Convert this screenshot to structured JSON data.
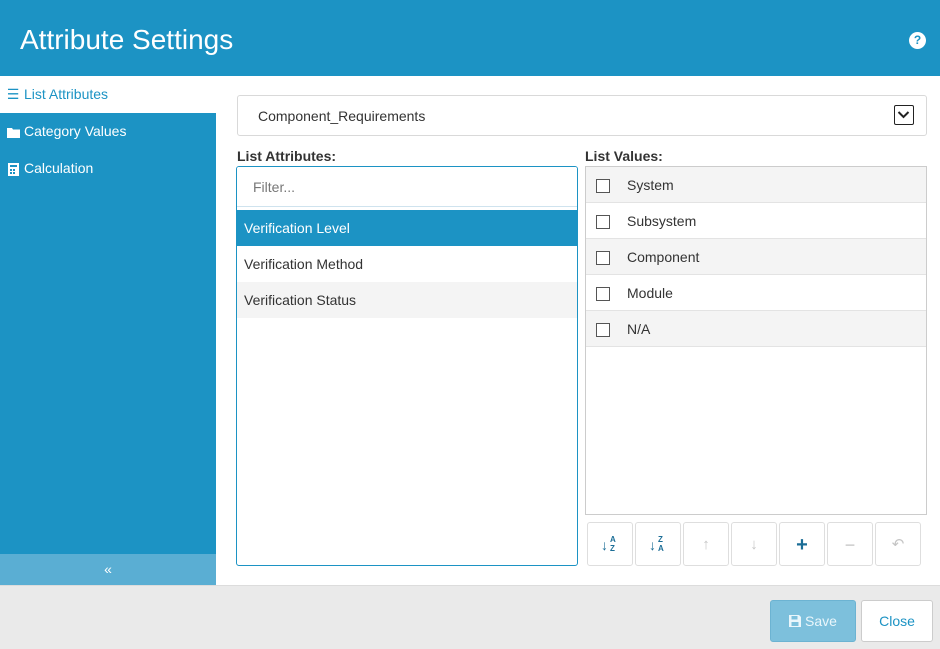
{
  "header": {
    "title": "Attribute Settings",
    "help_icon": "help-circle-icon"
  },
  "sidebar": {
    "items": [
      {
        "label": "List Attributes",
        "icon": "list-icon",
        "active": true
      },
      {
        "label": "Category Values",
        "icon": "folder-icon",
        "active": false
      },
      {
        "label": "Calculation",
        "icon": "calculator-icon",
        "active": false
      }
    ],
    "collapse_label": "«"
  },
  "dropdown": {
    "value": "Component_Requirements"
  },
  "attributes": {
    "label": "List Attributes:",
    "filter_placeholder": "Filter...",
    "items": [
      "Verification Level",
      "Verification Method",
      "Verification Status"
    ],
    "selected_index": 0
  },
  "values": {
    "label": "List Values:",
    "items": [
      "System",
      "Subsystem",
      "Component",
      "Module",
      "N/A"
    ]
  },
  "toolbar": {
    "buttons": [
      {
        "icon": "sort-ascending-icon",
        "enabled": true
      },
      {
        "icon": "sort-descending-icon",
        "enabled": true
      },
      {
        "icon": "move-up-icon",
        "enabled": false
      },
      {
        "icon": "move-down-icon",
        "enabled": false
      },
      {
        "icon": "add-icon",
        "enabled": true
      },
      {
        "icon": "remove-icon",
        "enabled": false
      },
      {
        "icon": "undo-icon",
        "enabled": false
      }
    ]
  },
  "footer": {
    "save_label": "Save",
    "close_label": "Close"
  },
  "colors": {
    "accent": "#1c93c4",
    "collapse_bar": "#5aaed3",
    "save_disabled": "#7dc0dc"
  }
}
